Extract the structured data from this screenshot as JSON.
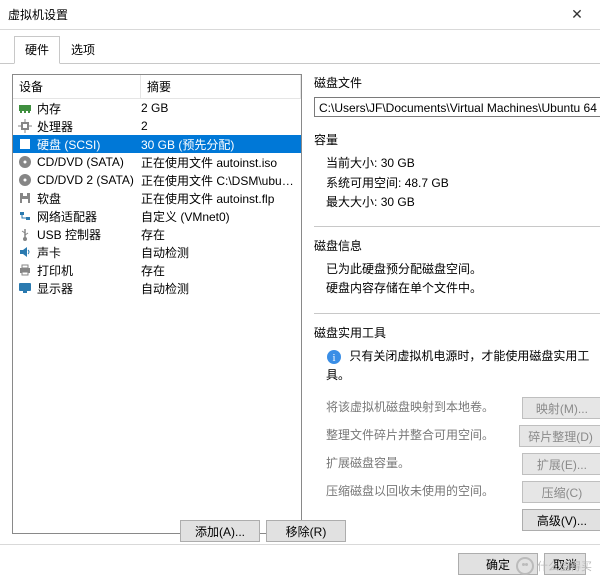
{
  "window": {
    "title": "虚拟机设置"
  },
  "tabs": {
    "hardware": "硬件",
    "options": "选项"
  },
  "list": {
    "head_device": "设备",
    "head_summary": "摘要"
  },
  "devices": [
    {
      "icon": "memory",
      "name": "内存",
      "summary": "2 GB"
    },
    {
      "icon": "cpu",
      "name": "处理器",
      "summary": "2"
    },
    {
      "icon": "disk",
      "name": "硬盘 (SCSI)",
      "summary": "30 GB (预先分配)",
      "selected": true
    },
    {
      "icon": "cd",
      "name": "CD/DVD (SATA)",
      "summary": "正在使用文件 autoinst.iso"
    },
    {
      "icon": "cd",
      "name": "CD/DVD 2 (SATA)",
      "summary": "正在使用文件 C:\\DSM\\ubuntu-..."
    },
    {
      "icon": "floppy",
      "name": "软盘",
      "summary": "正在使用文件 autoinst.flp"
    },
    {
      "icon": "net",
      "name": "网络适配器",
      "summary": "自定义 (VMnet0)"
    },
    {
      "icon": "usb",
      "name": "USB 控制器",
      "summary": "存在"
    },
    {
      "icon": "sound",
      "name": "声卡",
      "summary": "自动检测"
    },
    {
      "icon": "printer",
      "name": "打印机",
      "summary": "存在"
    },
    {
      "icon": "display",
      "name": "显示器",
      "summary": "自动检测"
    }
  ],
  "right": {
    "disk_file_title": "磁盘文件",
    "disk_file_path": "C:\\Users\\JF\\Documents\\Virtual Machines\\Ubuntu 64",
    "capacity_title": "容量",
    "current_label": "当前大小:",
    "current_value": "30 GB",
    "free_label": "系统可用空间:",
    "free_value": "48.7 GB",
    "max_label": "最大大小:",
    "max_value": "30 GB",
    "disk_info_title": "磁盘信息",
    "disk_info_line1": "已为此硬盘预分配磁盘空间。",
    "disk_info_line2": "硬盘内容存储在单个文件中。",
    "utilities_title": "磁盘实用工具",
    "tip": "只有关闭虚拟机电源时，才能使用磁盘实用工具。",
    "map_label": "将该虚拟机磁盘映射到本地卷。",
    "map_btn": "映射(M)...",
    "defrag_label": "整理文件碎片并整合可用空间。",
    "defrag_btn": "碎片整理(D)",
    "expand_label": "扩展磁盘容量。",
    "expand_btn": "扩展(E)...",
    "compact_label": "压缩磁盘以回收未使用的空间。",
    "compact_btn": "压缩(C)",
    "advanced_btn": "高级(V)..."
  },
  "buttons": {
    "add": "添加(A)...",
    "remove": "移除(R)",
    "ok": "确定",
    "cancel": "取消"
  },
  "watermark": "什么值得买"
}
